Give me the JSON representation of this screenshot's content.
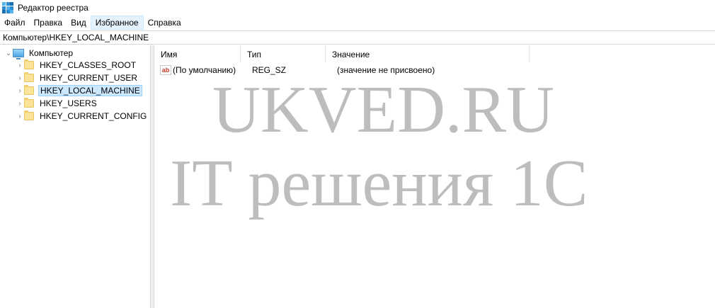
{
  "window": {
    "title": "Редактор реестра"
  },
  "menu": {
    "items": [
      {
        "label": "Файл",
        "active": false
      },
      {
        "label": "Правка",
        "active": false
      },
      {
        "label": "Вид",
        "active": false
      },
      {
        "label": "Избранное",
        "active": true
      },
      {
        "label": "Справка",
        "active": false
      }
    ]
  },
  "address": {
    "path": "Компьютер\\HKEY_LOCAL_MACHINE"
  },
  "tree": {
    "root": {
      "label": "Компьютер",
      "expanded": true
    },
    "items": [
      {
        "label": "HKEY_CLASSES_ROOT",
        "selected": false
      },
      {
        "label": "HKEY_CURRENT_USER",
        "selected": false
      },
      {
        "label": "HKEY_LOCAL_MACHINE",
        "selected": true
      },
      {
        "label": "HKEY_USERS",
        "selected": false
      },
      {
        "label": "HKEY_CURRENT_CONFIG",
        "selected": false
      }
    ]
  },
  "list": {
    "columns": [
      "Имя",
      "Тип",
      "Значение"
    ],
    "rows": [
      {
        "icon": "string-value-icon",
        "icon_text": "ab",
        "name": "(По умолчанию)",
        "type": "REG_SZ",
        "value": "(значение не присвоено)"
      }
    ]
  },
  "watermark": {
    "line1": "UKVED.RU",
    "line2": "IT решения 1С"
  }
}
